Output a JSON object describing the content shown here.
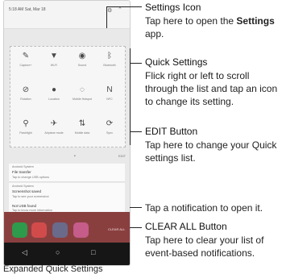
{
  "status": {
    "time": "5:18 AM Sat, Mar 18"
  },
  "quick_settings": {
    "tiles": [
      {
        "label": "Capture+",
        "icon": "capture-icon",
        "glyph": "✎"
      },
      {
        "label": "Wi-Fi",
        "icon": "wifi-icon",
        "glyph": "▼"
      },
      {
        "label": "Sound",
        "icon": "sound-icon",
        "glyph": "◉"
      },
      {
        "label": "Bluetooth",
        "icon": "bluetooth-icon",
        "glyph": "ᛒ"
      },
      {
        "label": "Rotation",
        "icon": "rotation-icon",
        "glyph": "⊘"
      },
      {
        "label": "Location",
        "icon": "location-icon",
        "glyph": "●"
      },
      {
        "label": "Mobile Hotspot",
        "icon": "hotspot-icon",
        "glyph": "◌"
      },
      {
        "label": "NFC",
        "icon": "nfc-icon",
        "glyph": "N"
      },
      {
        "label": "Flashlight",
        "icon": "flashlight-icon",
        "glyph": "⚲"
      },
      {
        "label": "Airplane mode",
        "icon": "airplane-icon",
        "glyph": "✈"
      },
      {
        "label": "Mobile data",
        "icon": "mobile-data-icon",
        "glyph": "⇅"
      },
      {
        "label": "Sync",
        "icon": "sync-icon",
        "glyph": "⟳"
      }
    ],
    "edit_label": "EDIT",
    "page_indicator": "•"
  },
  "notifications": [
    {
      "source": "Android System",
      "title": "File transfer",
      "text": "Tap to change USB options"
    },
    {
      "source": "Android System",
      "title": "Screenshot saved",
      "text": "Tap to see your screenshot"
    },
    {
      "source": "",
      "title": "Not USB found",
      "text": "Tap to know more information"
    }
  ],
  "home": {
    "clear_all_label": "CLEAR ALL"
  },
  "callouts": {
    "settings_icon": {
      "title": "Settings Icon",
      "text_pre": "Tap here to open the ",
      "text_bold": "Settings",
      "text_post": " app."
    },
    "quick_settings": {
      "title": "Quick Settings",
      "text": "Flick right or left to scroll through the list and tap an icon to change its setting."
    },
    "edit_button": {
      "title": "EDIT Button",
      "text": "Tap here to change your Quick settings list."
    },
    "tap_notification": {
      "text": "Tap a notification to open it."
    },
    "clear_all_button": {
      "title": "CLEAR ALL Button",
      "text": "Tap here to clear your list of event-based notifications."
    }
  },
  "caption": "Expanded Quick Settings"
}
